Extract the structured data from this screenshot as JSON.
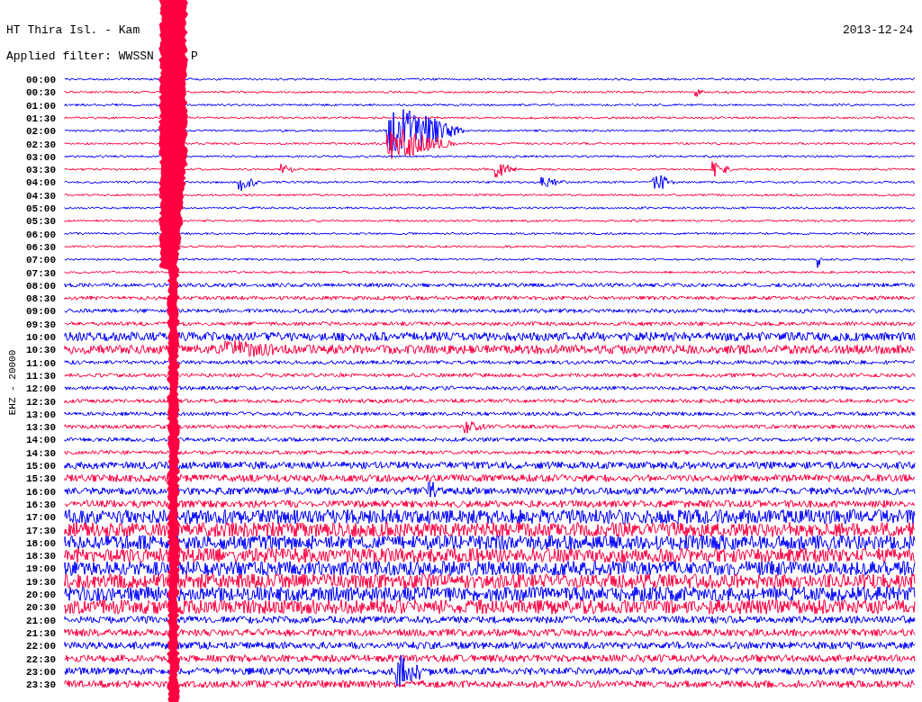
{
  "station_title": "HT Thira Isl. - Kam",
  "filter_label": "Applied filter: WWSSN",
  "filter_tail": "P",
  "date": "2013-12-24",
  "axis_label": "EHZ - 20000",
  "rows": [
    {
      "time": "00:00",
      "color": "#0000ff"
    },
    {
      "time": "00:30",
      "color": "#ff0040"
    },
    {
      "time": "01:00",
      "color": "#0000ff"
    },
    {
      "time": "01:30",
      "color": "#ff0040"
    },
    {
      "time": "02:00",
      "color": "#0000ff"
    },
    {
      "time": "02:30",
      "color": "#ff0040"
    },
    {
      "time": "03:00",
      "color": "#0000ff"
    },
    {
      "time": "03:30",
      "color": "#ff0040"
    },
    {
      "time": "04:00",
      "color": "#0000ff"
    },
    {
      "time": "04:30",
      "color": "#ff0040"
    },
    {
      "time": "05:00",
      "color": "#0000ff"
    },
    {
      "time": "05:30",
      "color": "#ff0040"
    },
    {
      "time": "06:00",
      "color": "#0000ff"
    },
    {
      "time": "06:30",
      "color": "#ff0040"
    },
    {
      "time": "07:00",
      "color": "#0000ff"
    },
    {
      "time": "07:30",
      "color": "#ff0040"
    },
    {
      "time": "08:00",
      "color": "#0000ff"
    },
    {
      "time": "08:30",
      "color": "#ff0040"
    },
    {
      "time": "09:00",
      "color": "#0000ff"
    },
    {
      "time": "09:30",
      "color": "#ff0040"
    },
    {
      "time": "10:00",
      "color": "#0000ff"
    },
    {
      "time": "10:30",
      "color": "#ff0040"
    },
    {
      "time": "11:00",
      "color": "#0000ff"
    },
    {
      "time": "11:30",
      "color": "#ff0040"
    },
    {
      "time": "12:00",
      "color": "#0000ff"
    },
    {
      "time": "12:30",
      "color": "#ff0040"
    },
    {
      "time": "13:00",
      "color": "#0000ff"
    },
    {
      "time": "13:30",
      "color": "#ff0040"
    },
    {
      "time": "14:00",
      "color": "#0000ff"
    },
    {
      "time": "14:30",
      "color": "#ff0040"
    },
    {
      "time": "15:00",
      "color": "#0000ff"
    },
    {
      "time": "15:30",
      "color": "#ff0040"
    },
    {
      "time": "16:00",
      "color": "#0000ff"
    },
    {
      "time": "16:30",
      "color": "#ff0040"
    },
    {
      "time": "17:00",
      "color": "#0000ff"
    },
    {
      "time": "17:30",
      "color": "#ff0040"
    },
    {
      "time": "18:00",
      "color": "#0000ff"
    },
    {
      "time": "18:30",
      "color": "#ff0040"
    },
    {
      "time": "19:00",
      "color": "#0000ff"
    },
    {
      "time": "19:30",
      "color": "#ff0040"
    },
    {
      "time": "20:00",
      "color": "#0000ff"
    },
    {
      "time": "20:30",
      "color": "#ff0040"
    },
    {
      "time": "21:00",
      "color": "#0000ff"
    },
    {
      "time": "21:30",
      "color": "#ff0040"
    },
    {
      "time": "22:00",
      "color": "#0000ff"
    },
    {
      "time": "22:30",
      "color": "#ff0040"
    },
    {
      "time": "23:00",
      "color": "#0000ff"
    },
    {
      "time": "23:30",
      "color": "#ff0040"
    }
  ]
}
